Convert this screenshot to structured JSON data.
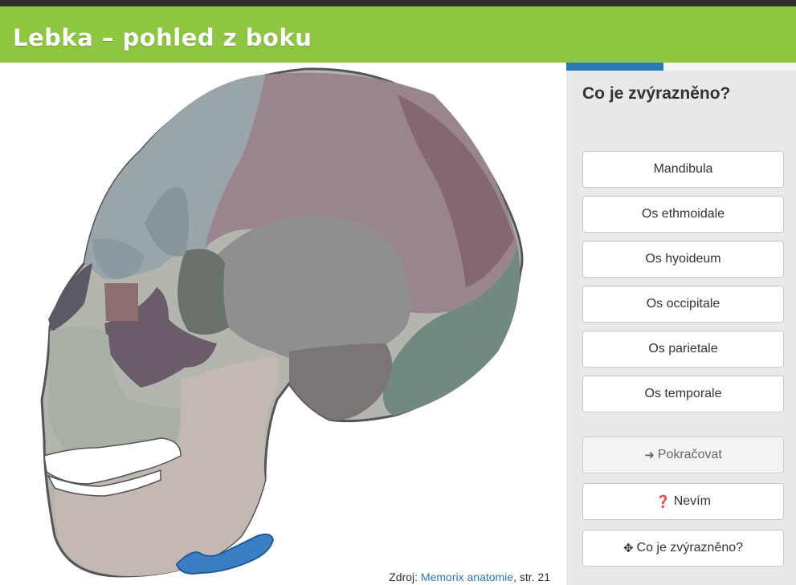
{
  "header": {
    "title": "Lebka – pohled z boku"
  },
  "source": {
    "prefix": "Zdroj: ",
    "link_text": "Memorix anatomie",
    "suffix": ", str. 21"
  },
  "quiz": {
    "progress": 0.42,
    "question": "Co je zvýrazněno?",
    "options": [
      "Mandibula",
      "Os ethmoidale",
      "Os hyoideum",
      "Os occipitale",
      "Os parietale",
      "Os temporale"
    ],
    "continue_label": "Pokračovat",
    "dont_know_label": "Nevím",
    "hint_label": "Co je zvýrazněno?"
  },
  "colors": {
    "accent": "#8dc63f",
    "highlight": "#3a7fc4",
    "link": "#2a7ab8"
  }
}
